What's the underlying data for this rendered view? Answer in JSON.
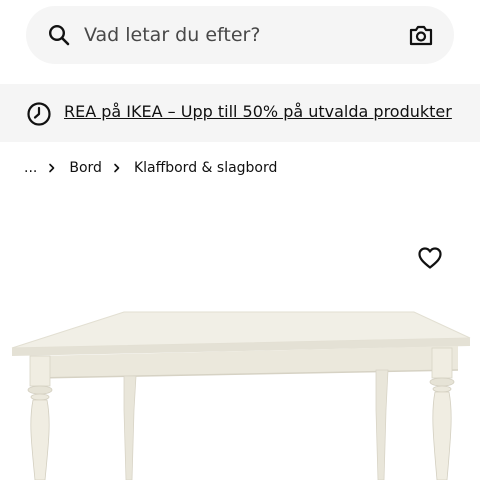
{
  "search": {
    "placeholder": "Vad letar du efter?",
    "search_icon": "search-icon",
    "camera_icon": "camera-icon"
  },
  "promo": {
    "icon": "clock-icon",
    "text": "REA på IKEA – Upp till 50% på utvalda produkter"
  },
  "breadcrumb": {
    "items": [
      "...",
      "Bord",
      "Klaffbord & slagbord"
    ],
    "separator_icon": "chevron-right-icon"
  },
  "product": {
    "favorite_icon": "heart-outline-icon",
    "image": "white-dining-table"
  },
  "colors": {
    "background": "#ffffff",
    "search_bg": "#f5f5f5",
    "banner_bg": "#f5f5f5",
    "text": "#111111"
  }
}
